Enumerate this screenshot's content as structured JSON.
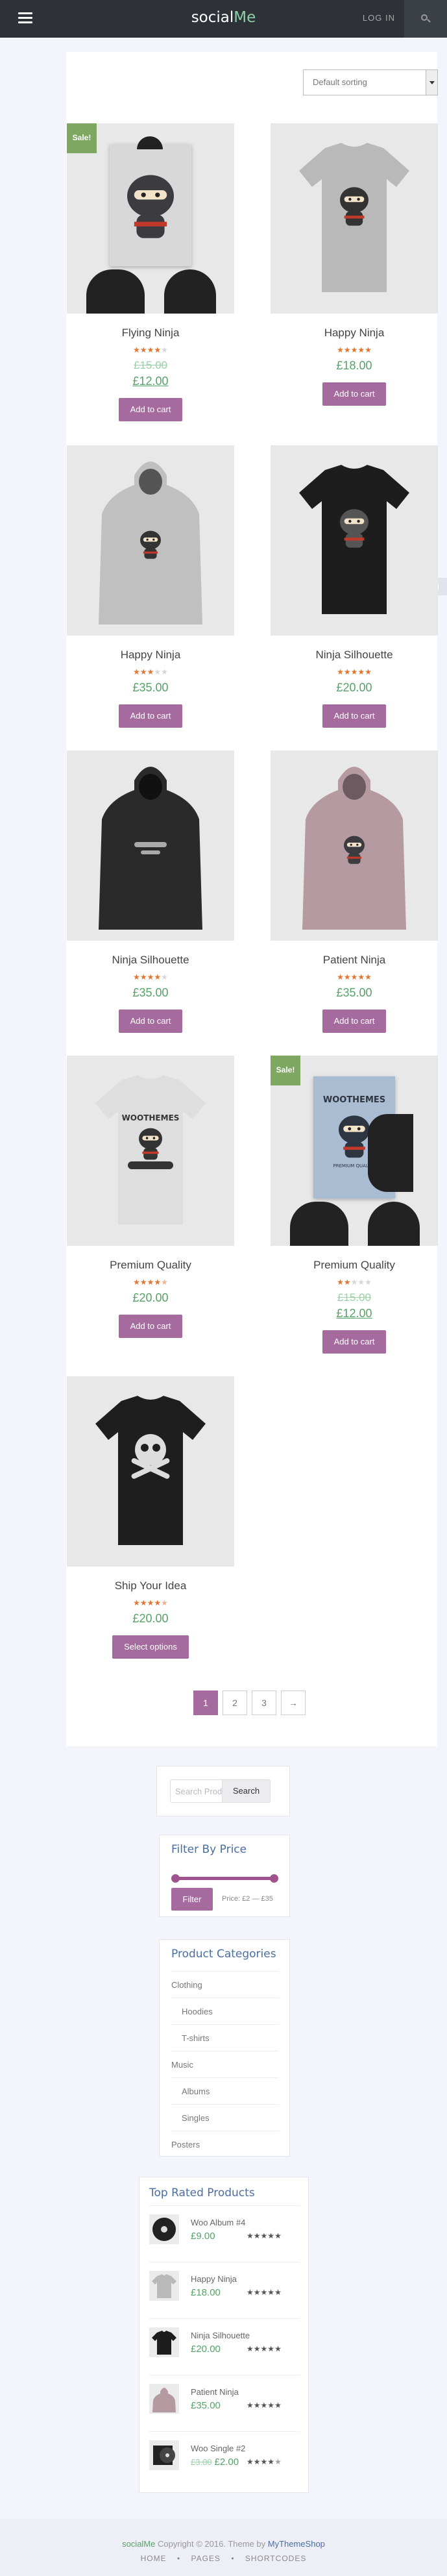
{
  "header": {
    "logo_main": "social",
    "logo_accent": "Me",
    "login": "LOG IN"
  },
  "sorting": {
    "selected": "Default sorting"
  },
  "products": [
    {
      "name": "Flying Ninja",
      "rating": 4,
      "sale": "Sale!",
      "old_price": "£15.00",
      "price": "£12.00",
      "button": "Add to cart",
      "image": "poster-ninja"
    },
    {
      "name": "Happy Ninja",
      "rating": 5,
      "price": "£18.00",
      "button": "Add to cart",
      "image": "grey-tshirt-ninja"
    },
    {
      "name": "Happy Ninja",
      "rating": 3,
      "price": "£35.00",
      "button": "Add to cart",
      "image": "grey-hoodie-ninja"
    },
    {
      "name": "Ninja Silhouette",
      "rating": 5,
      "price": "£20.00",
      "button": "Add to cart",
      "image": "black-tshirt-ninja"
    },
    {
      "name": "Ninja Silhouette",
      "rating": 4,
      "price": "£35.00",
      "button": "Add to cart",
      "image": "black-hoodie-ninja"
    },
    {
      "name": "Patient Ninja",
      "rating": 5,
      "price": "£35.00",
      "button": "Add to cart",
      "image": "pink-hoodie-ninja"
    },
    {
      "name": "Premium Quality",
      "rating": 4.5,
      "price": "£20.00",
      "button": "Add to cart",
      "image": "white-tshirt-woo"
    },
    {
      "name": "Premium Quality",
      "rating": 2,
      "sale": "Sale!",
      "old_price": "£15.00",
      "price": "£12.00",
      "button": "Add to cart",
      "image": "poster-woo"
    },
    {
      "name": "Ship Your Idea",
      "rating": 4.5,
      "price": "£20.00",
      "button": "Select options",
      "image": "black-tshirt-skull"
    }
  ],
  "pagination": [
    "1",
    "2",
    "3",
    "→"
  ],
  "search_widget": {
    "placeholder": "Search Products…",
    "button": "Search"
  },
  "price_filter": {
    "title": "Filter By Price",
    "button": "Filter",
    "label": "Price: £2 — £35"
  },
  "categories": {
    "title": "Product Categories",
    "items": [
      {
        "label": "Clothing",
        "sub": false
      },
      {
        "label": "Hoodies",
        "sub": true
      },
      {
        "label": "T-shirts",
        "sub": true
      },
      {
        "label": "Music",
        "sub": false
      },
      {
        "label": "Albums",
        "sub": true
      },
      {
        "label": "Singles",
        "sub": true
      },
      {
        "label": "Posters",
        "sub": false
      }
    ]
  },
  "top_rated": {
    "title": "Top Rated Products",
    "items": [
      {
        "name": "Woo Album #4",
        "price": "£9.00",
        "rating": 5,
        "thumb": "album"
      },
      {
        "name": "Happy Ninja",
        "price": "£18.00",
        "rating": 5,
        "thumb": "grey-tshirt"
      },
      {
        "name": "Ninja Silhouette",
        "price": "£20.00",
        "rating": 5,
        "thumb": "black-tshirt"
      },
      {
        "name": "Patient Ninja",
        "price": "£35.00",
        "rating": 5,
        "thumb": "pink-hoodie"
      },
      {
        "name": "Woo Single #2",
        "old_price": "£3.00",
        "price": "£2.00",
        "rating": 4.5,
        "thumb": "single"
      }
    ]
  },
  "footer": {
    "brand": "socialMe",
    "copyright": " Copyright © 2016. Theme by ",
    "author": "MyThemeShop",
    "nav": [
      "HOME",
      "PAGES",
      "SHORTCODES"
    ],
    "separator": "•"
  },
  "colors": {
    "accent": "#a66b9e",
    "price_green": "#58a268",
    "header_bg": "#2e3238",
    "star": "#e0762f",
    "sale_badge": "#7ea862"
  }
}
